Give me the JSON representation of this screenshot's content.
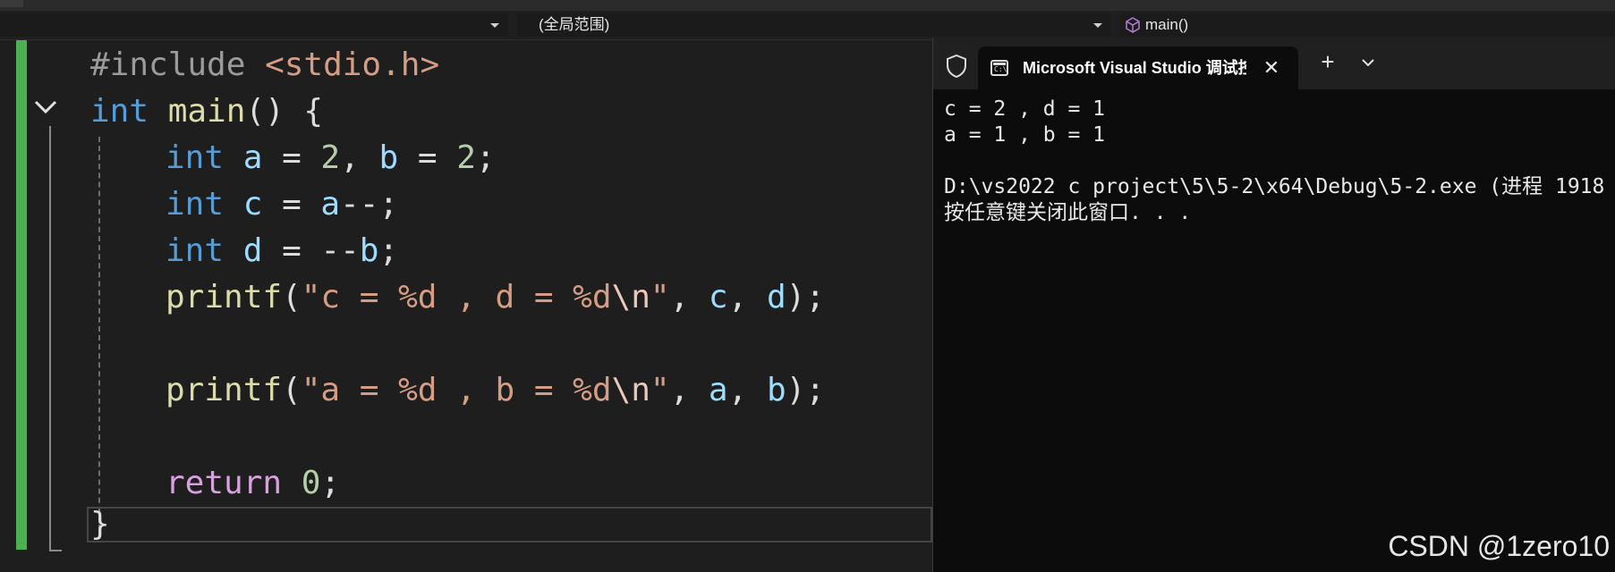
{
  "navbar": {
    "project_combo": "",
    "scope_combo": "(全局范围)",
    "function_combo": "main()"
  },
  "editor": {
    "lines": [
      {
        "pp": "#include",
        "inc": " <stdio.h>"
      },
      {
        "kw": "int",
        "fn": " main",
        "punc": "() {"
      },
      {
        "kw": "int",
        "var1": " a",
        "op1": " = ",
        "num1": "2",
        "sep": ", ",
        "var2": "b",
        "op2": " = ",
        "num2": "2",
        "end": ";"
      },
      {
        "kw": "int",
        "var": " c",
        "op": " = ",
        "var2": "a",
        "end": "--;"
      },
      {
        "kw": "int",
        "var": " d",
        "op": " = --",
        "var2": "b",
        "end": ";"
      },
      {
        "fn": "printf",
        "open": "(",
        "str1": "\"c = %d , d = %d",
        "esc": "\\n",
        "str2": "\"",
        "sep1": ", ",
        "v1": "c",
        "sep2": ", ",
        "v2": "d",
        "end": ");"
      },
      {
        "fn": "printf",
        "open": "(",
        "str1": "\"a = %d , b = %d",
        "esc": "\\n",
        "str2": "\"",
        "sep1": ", ",
        "v1": "a",
        "sep2": ", ",
        "v2": "b",
        "end": ");"
      },
      {
        "ctl": "return",
        "num": " 0",
        "end": ";"
      },
      {
        "punc": "}"
      }
    ]
  },
  "terminal": {
    "tab_title": "Microsoft Visual Studio 调试控制台",
    "output": [
      "c = 2 , d = 1",
      "a = 1 , b = 1",
      "",
      "D:\\vs2022 c project\\5\\5-2\\x64\\Debug\\5-2.exe (进程 1918",
      "按任意键关闭此窗口. . ."
    ]
  },
  "watermark": "CSDN @1zero10",
  "icons": [
    "dropdown-arrow-icon",
    "cube-icon",
    "collapse-chevron-icon",
    "shield-icon",
    "console-icon",
    "close-icon",
    "plus-icon",
    "chevron-down-icon"
  ]
}
